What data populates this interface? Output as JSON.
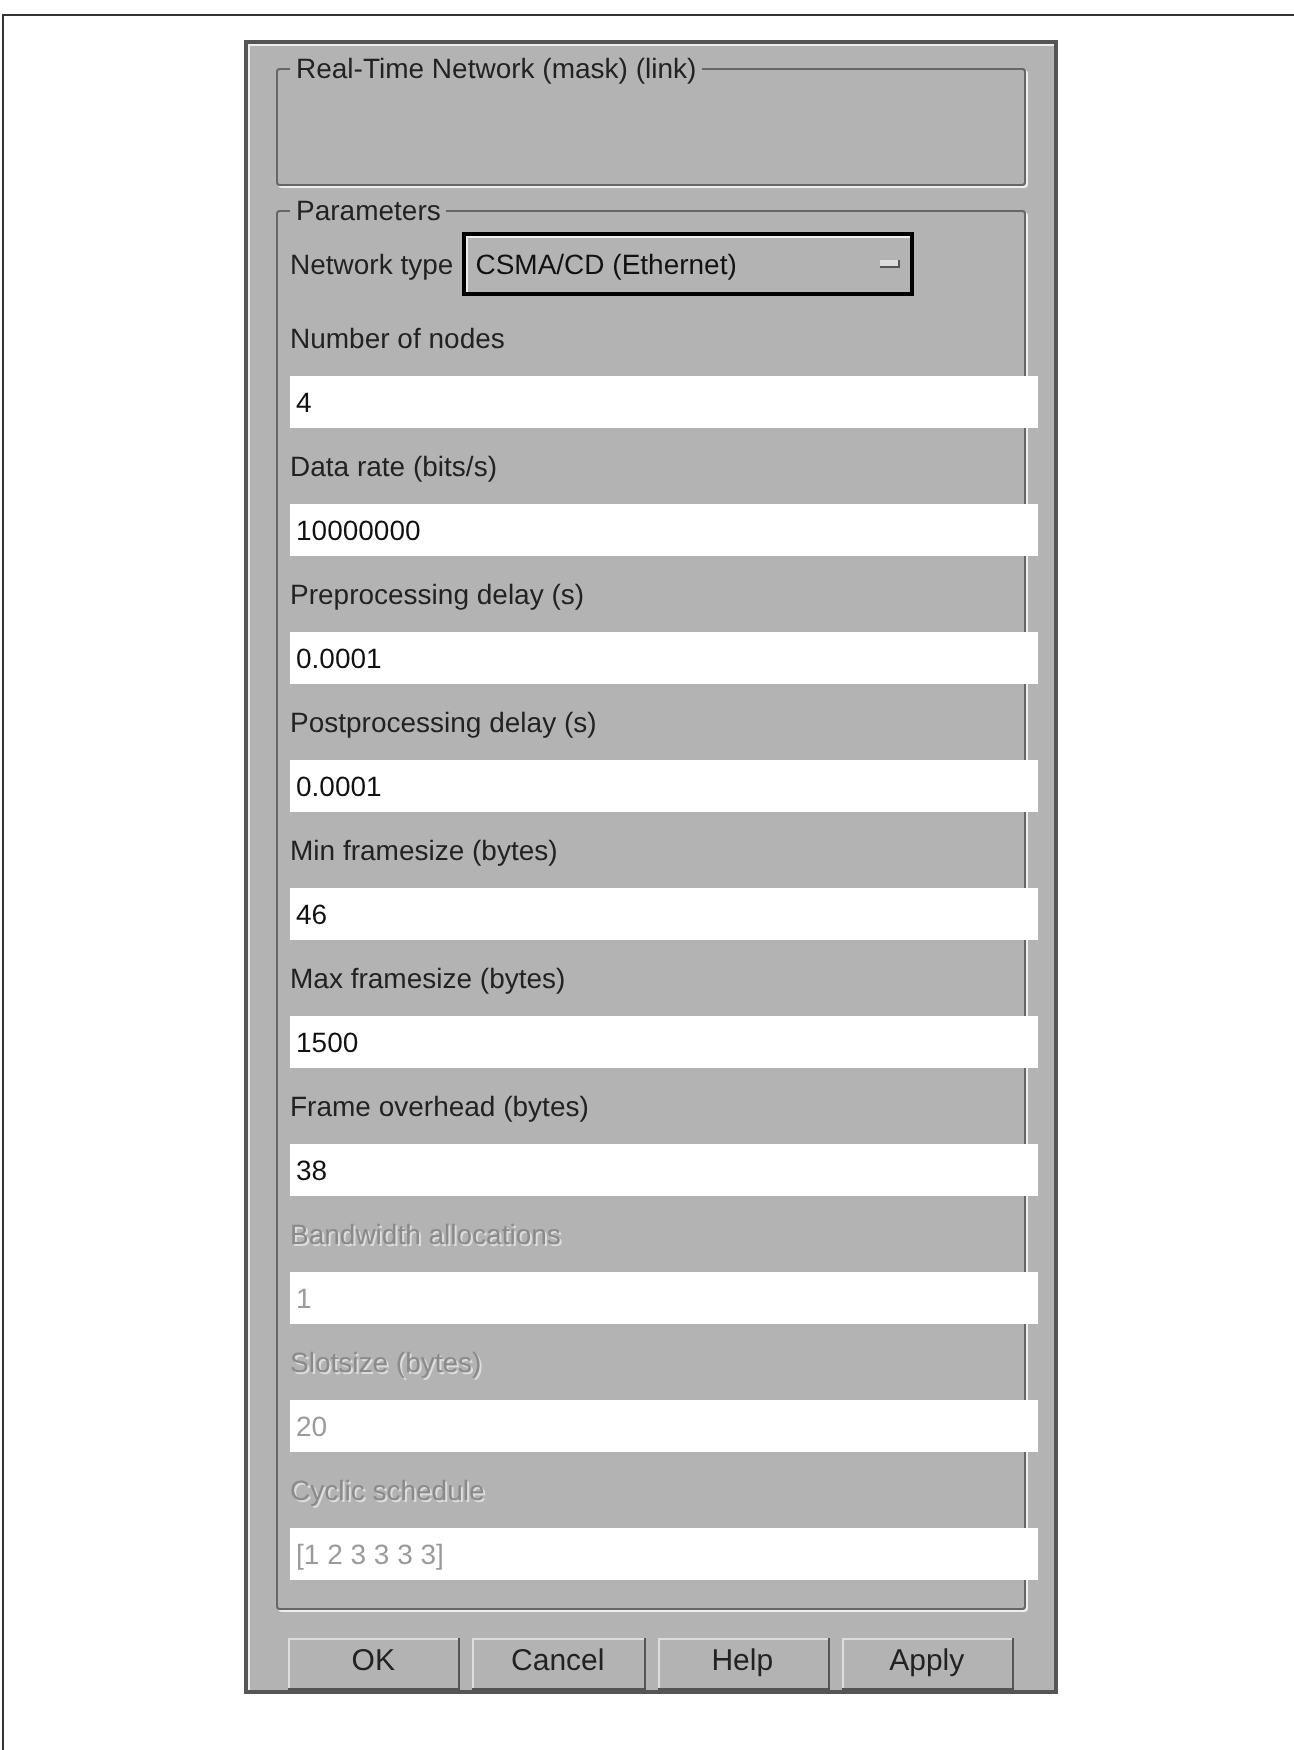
{
  "mask_group": {
    "title": "Real-Time Network (mask) (link)"
  },
  "parameters": {
    "title": "Parameters",
    "network_type": {
      "label": "Network type",
      "value": "CSMA/CD (Ethernet)"
    },
    "fields": [
      {
        "label": "Number of nodes",
        "value": "4",
        "disabled": false
      },
      {
        "label": "Data rate (bits/s)",
        "value": "10000000",
        "disabled": false
      },
      {
        "label": "Preprocessing delay (s)",
        "value": "0.0001",
        "disabled": false
      },
      {
        "label": "Postprocessing delay (s)",
        "value": "0.0001",
        "disabled": false
      },
      {
        "label": "Min framesize (bytes)",
        "value": "46",
        "disabled": false
      },
      {
        "label": "Max framesize (bytes)",
        "value": "1500",
        "disabled": false
      },
      {
        "label": "Frame overhead (bytes)",
        "value": "38",
        "disabled": false
      },
      {
        "label": "Bandwidth allocations",
        "value": "1",
        "disabled": true
      },
      {
        "label": "Slotsize (bytes)",
        "value": "20",
        "disabled": true
      },
      {
        "label": "Cyclic schedule",
        "value": "[1 2 3 3 3 3]",
        "disabled": true
      }
    ]
  },
  "buttons": [
    "OK",
    "Cancel",
    "Help",
    "Apply"
  ]
}
